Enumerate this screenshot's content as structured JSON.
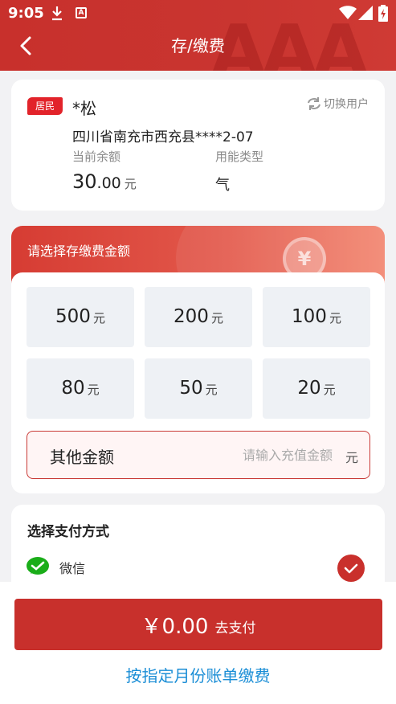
{
  "status_bar": {
    "time": "9:05"
  },
  "header": {
    "title": "存/缴费"
  },
  "user": {
    "badge": "居民",
    "name": "*松",
    "switch_label": "切换用户",
    "address": "四川省南充市西充县****2-07",
    "balance_label": "当前余额",
    "energy_label": "用能类型",
    "balance_int": "30",
    "balance_dec": ".00",
    "balance_unit": "元",
    "energy_type": "气"
  },
  "amount": {
    "title": "请选择存缴费金额",
    "unit": "元",
    "options": [
      "500",
      "200",
      "100",
      "80",
      "50",
      "20"
    ],
    "other_label": "其他金额",
    "other_placeholder": "请输入充值金额",
    "other_unit": "元"
  },
  "payment": {
    "title": "选择支付方式",
    "method": "微信"
  },
  "footer": {
    "pay_amount": "￥0.00",
    "pay_action": "去支付",
    "bill_link": "按指定月份账单缴费"
  },
  "colors": {
    "primary": "#c8302c",
    "link": "#1b8ed6",
    "wechat": "#1aad19"
  }
}
